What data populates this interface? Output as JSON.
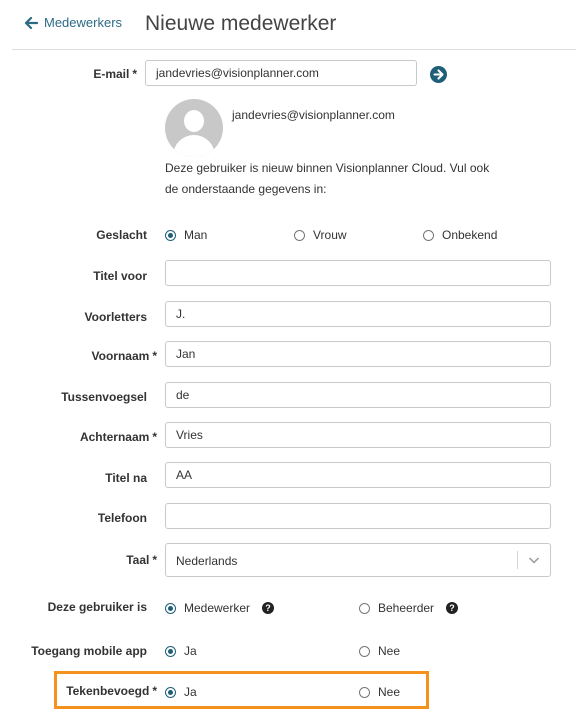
{
  "header": {
    "back_label": "Medewerkers",
    "title": "Nieuwe medewerker"
  },
  "form": {
    "email": {
      "label": "E-mail",
      "value": "jandevries@visionplanner.com"
    },
    "user_email": "jandevries@visionplanner.com",
    "info_text": "Deze gebruiker is nieuw binnen Visionplanner Cloud. Vul ook de onderstaande gegevens in:",
    "required_marker": "*",
    "gender": {
      "label": "Geslacht",
      "options": [
        "Man",
        "Vrouw",
        "Onbekend"
      ],
      "selected": "Man"
    },
    "title_before": {
      "label": "Titel voor",
      "value": ""
    },
    "initials": {
      "label": "Voorletters",
      "value": "J."
    },
    "first_name": {
      "label": "Voornaam",
      "value": "Jan"
    },
    "infix": {
      "label": "Tussenvoegsel",
      "value": "de"
    },
    "last_name": {
      "label": "Achternaam",
      "value": "Vries"
    },
    "title_after": {
      "label": "Titel na",
      "value": "AA"
    },
    "phone": {
      "label": "Telefoon",
      "value": ""
    },
    "language": {
      "label": "Taal",
      "value": "Nederlands"
    },
    "user_role": {
      "label": "Deze gebruiker is",
      "options": [
        "Medewerker",
        "Beheerder"
      ],
      "selected": "Medewerker",
      "help_glyph": "?"
    },
    "mobile_access": {
      "label": "Toegang mobile app",
      "options": [
        "Ja",
        "Nee"
      ],
      "selected": "Ja"
    },
    "signing_authority": {
      "label": "Tekenbevoegd",
      "options": [
        "Ja",
        "Nee"
      ],
      "selected": "Ja"
    }
  },
  "colors": {
    "accent": "#1f5e78",
    "link": "#2c6b86",
    "highlight": "#f5921e"
  }
}
